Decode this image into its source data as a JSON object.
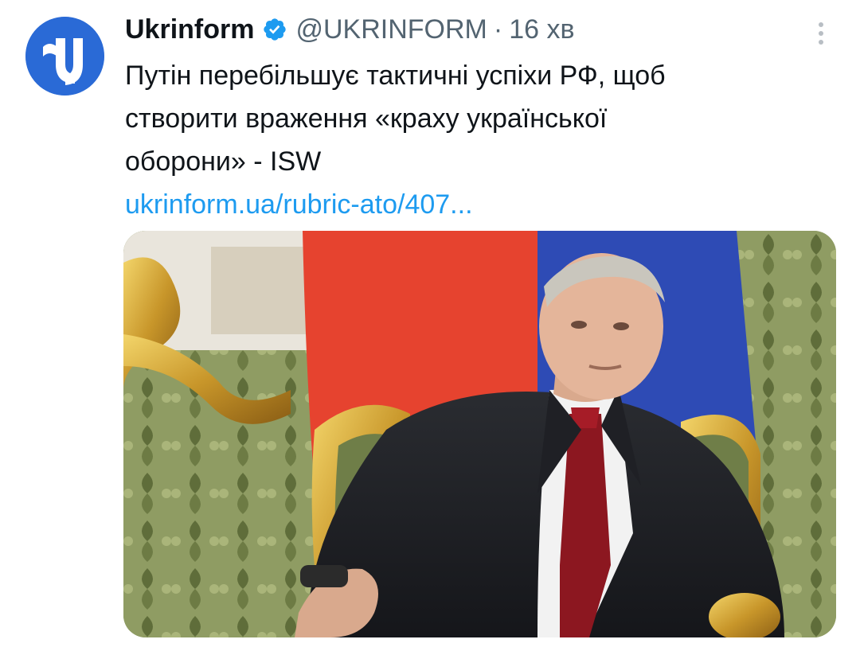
{
  "tweet": {
    "display_name": "Ukrinform",
    "handle": "@UKRINFORM",
    "separator": "·",
    "time": "16 хв",
    "text_lines": [
      "Путін перебільшує тактичні успіхи РФ, щоб",
      "створити враження «краху української",
      "оборони» - ISW"
    ],
    "link": "ukrinform.ua/rubric-ato/407..."
  },
  "icons": {
    "avatar": "ukrinform-logo-icon",
    "verified": "verified-badge-icon",
    "more": "more-vertical-icon"
  },
  "colors": {
    "text": "#0f1419",
    "secondary": "#536471",
    "link": "#1d9bf0",
    "avatar_bg": "#2a6ad6",
    "verified": "#1d9bf0"
  }
}
